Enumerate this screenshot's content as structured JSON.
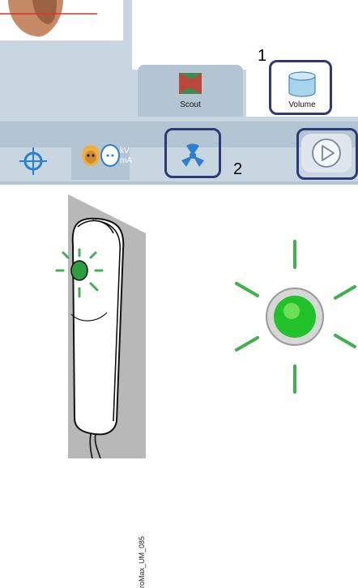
{
  "view_tabs": {
    "scout_label": "Scout",
    "volume_label": "Volume"
  },
  "tool_tabs": {
    "kv_label": "kV",
    "ma_label": "mA"
  },
  "callouts": {
    "one": "1",
    "two": "2"
  },
  "illustration": {
    "caption": "roMax_UM_085"
  },
  "colors": {
    "panel": "#c8d6e2",
    "tab": "#b3c5d3",
    "highlight": "#2c3a78",
    "ray": "#2ea44f",
    "button_green": "#22c22a"
  },
  "icons": [
    "crosshair-icon",
    "patient-head-icon",
    "radiation-icon",
    "play-icon",
    "volume-cylinder-icon",
    "scout-icon",
    "led-light-icon"
  ]
}
